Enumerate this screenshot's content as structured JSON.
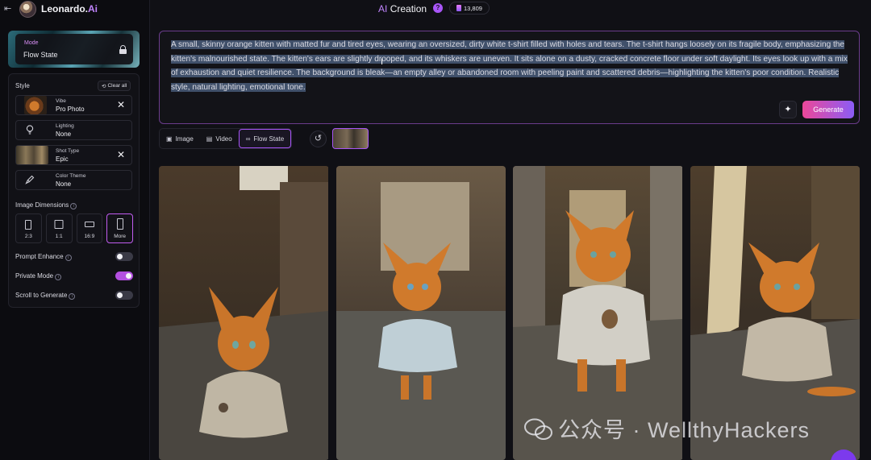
{
  "app": {
    "name": "Leonardo.",
    "name_suffix": "Ai"
  },
  "header": {
    "title_prefix": "AI",
    "title": "Creation",
    "help_glyph": "?",
    "token_count": "13,809"
  },
  "sidebar": {
    "mode": {
      "label": "Mode",
      "value": "Flow State"
    },
    "style_title": "Style",
    "clear_all": "Clear all",
    "options": [
      {
        "label": "Vibe",
        "value": "Pro Photo",
        "icon": "vibe-thumbnail"
      },
      {
        "label": "Lighting",
        "value": "None",
        "icon": "bulb-icon"
      },
      {
        "label": "Shot Type",
        "value": "Epic",
        "icon": "shot-thumbnail"
      },
      {
        "label": "Color Theme",
        "value": "None",
        "icon": "paint-icon"
      }
    ],
    "dimensions_title": "Image Dimensions",
    "dimensions": [
      "2:3",
      "1:1",
      "16:9",
      "More"
    ],
    "dimensions_selected": "More",
    "toggles": [
      {
        "label": "Prompt Enhance",
        "on": false
      },
      {
        "label": "Private Mode",
        "on": true
      },
      {
        "label": "Scroll to Generate",
        "on": false
      }
    ]
  },
  "prompt": {
    "text": "A small, skinny orange kitten with matted fur and tired eyes, wearing an oversized, dirty white t-shirt filled with holes and tears. The t-shirt hangs loosely on its fragile body, emphasizing the kitten's malnourished state. The kitten's ears are slightly drooped, and its whiskers are uneven. It sits alone on a dusty, cracked concrete floor under soft daylight. Its eyes look up with a mix of exhaustion and quiet resilience. The background is bleak—an empty alley or abandoned room with peeling paint and scattered debris—highlighting the kitten's poor condition. Realistic style, natural lighting, emotional tone.",
    "generate_label": "Generate"
  },
  "tabs": [
    {
      "label": "Image",
      "icon": "image-icon"
    },
    {
      "label": "Video",
      "icon": "video-icon"
    },
    {
      "label": "Flow State",
      "icon": "infinity-icon",
      "active": true
    }
  ],
  "watermark": "公众号 · WellthyHackers",
  "colors": {
    "accent": "#a855f7",
    "generate_start": "#ec4899",
    "generate_end": "#8b5cf6",
    "toggle_on": "#b34fe0"
  }
}
